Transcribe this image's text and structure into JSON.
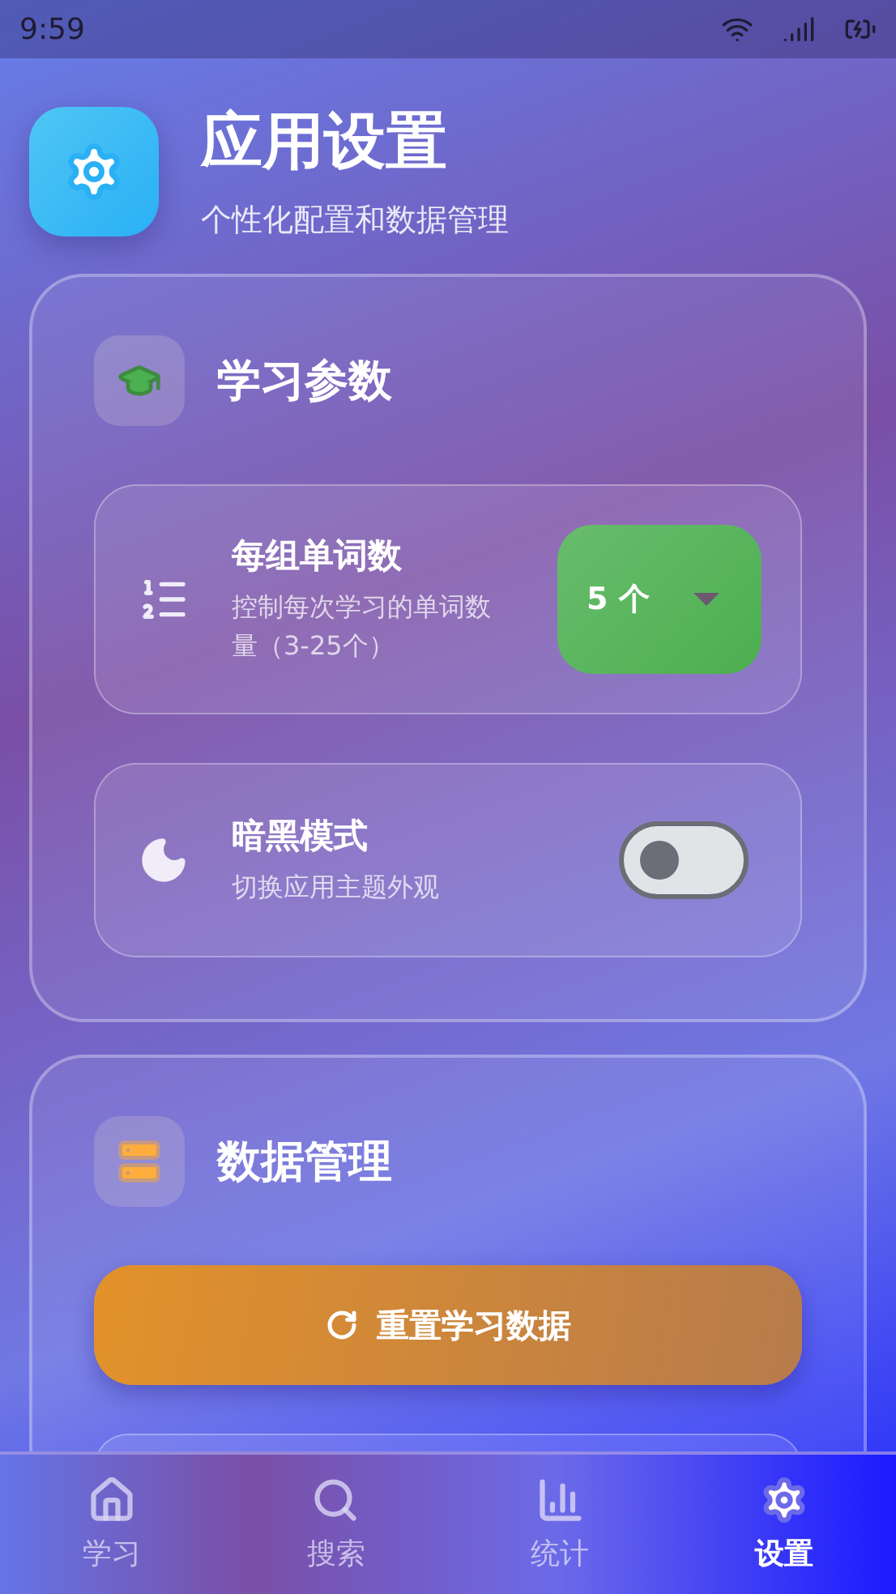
{
  "status_bar": {
    "time": "9:59"
  },
  "header": {
    "title": "应用设置",
    "subtitle": "个性化配置和数据管理"
  },
  "sections": [
    {
      "title": "学习参数",
      "settings": [
        {
          "kind": "select",
          "title": "每组单词数",
          "description": "控制每次学习的单词数量（3-25个）",
          "value": "5 个"
        },
        {
          "kind": "toggle",
          "title": "暗黑模式",
          "description": "切换应用主题外观",
          "on": false
        }
      ]
    },
    {
      "title": "数据管理",
      "actions": [
        {
          "label": "重置学习数据"
        }
      ]
    }
  ],
  "bottom_nav": [
    {
      "label": "学习",
      "selected": false
    },
    {
      "label": "搜索",
      "selected": false
    },
    {
      "label": "统计",
      "selected": false
    },
    {
      "label": "设置",
      "selected": true
    }
  ]
}
